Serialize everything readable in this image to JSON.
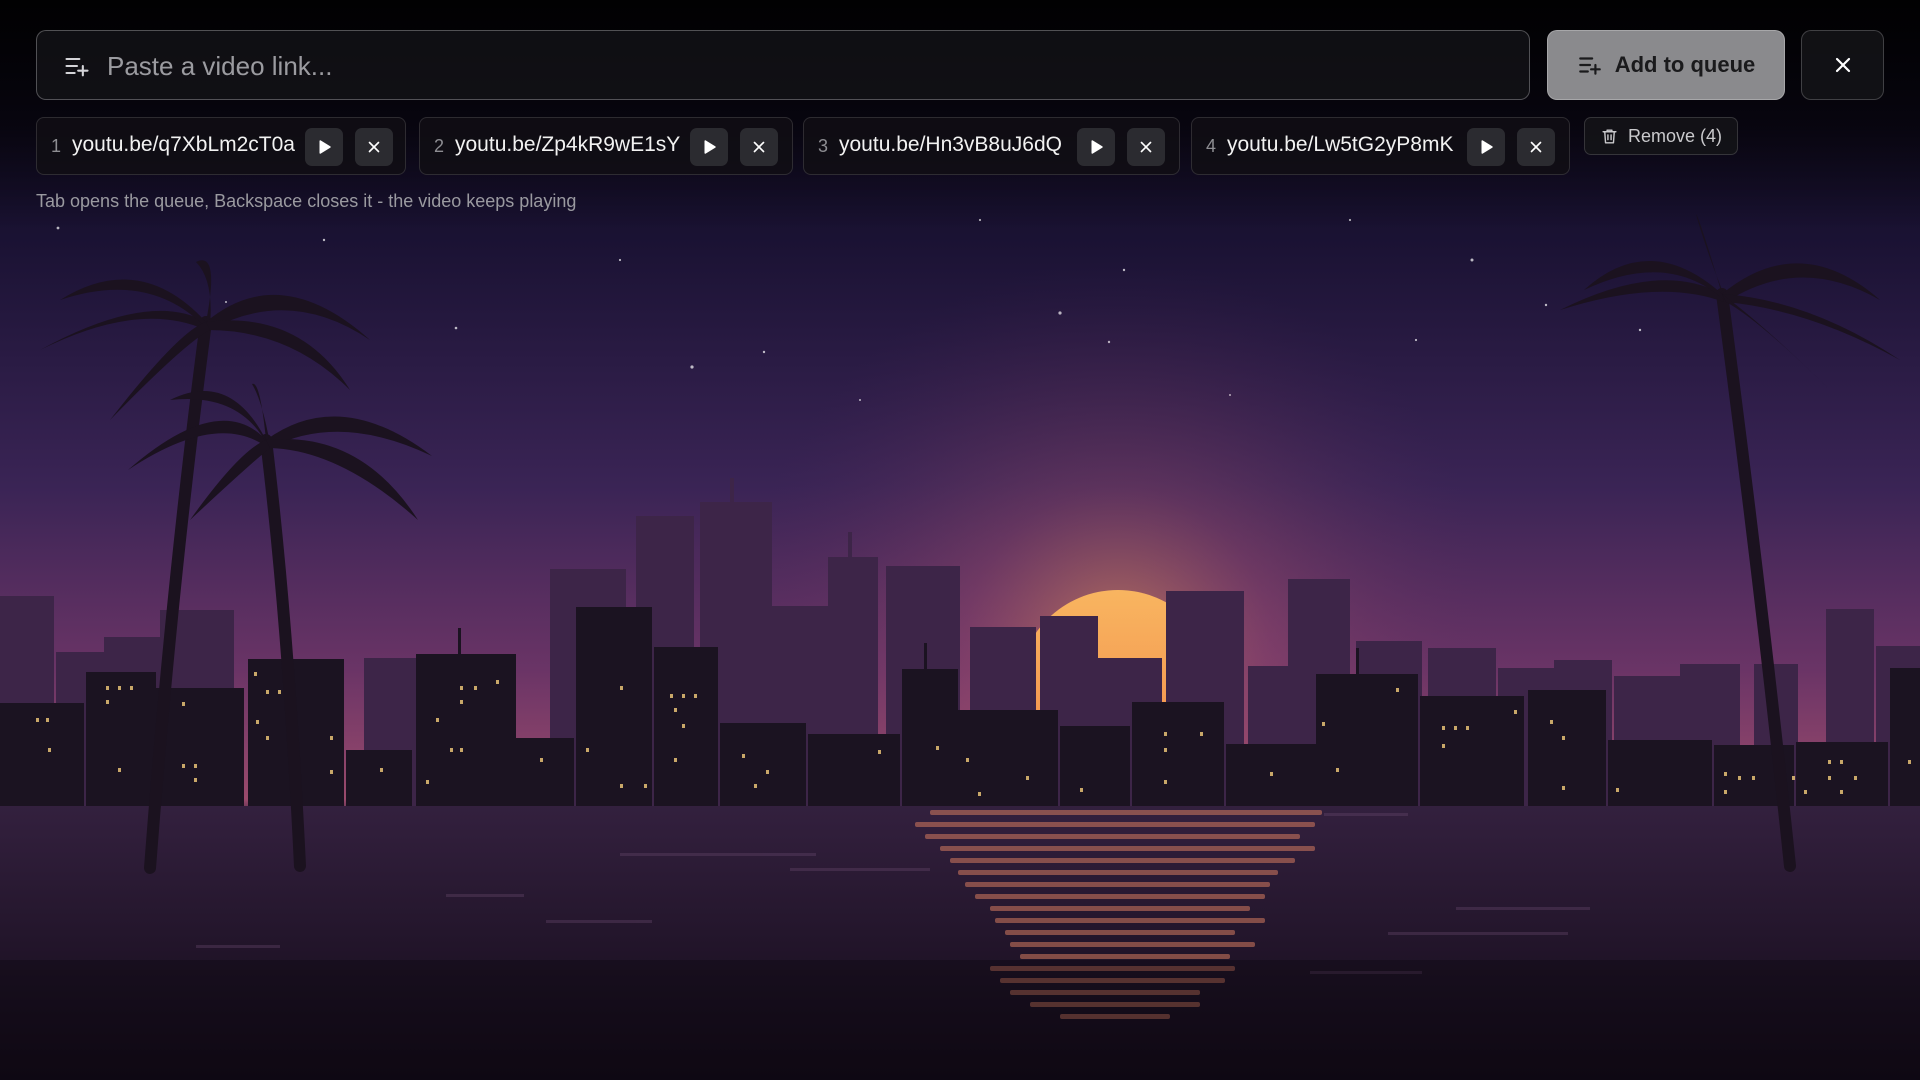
{
  "url_bar": {
    "placeholder": "Paste a video link...",
    "value": "",
    "icon": "playlist-add-icon"
  },
  "add_button": {
    "label": "Add to queue",
    "icon": "playlist-add-icon"
  },
  "close_button": {
    "icon": "close-icon"
  },
  "queue": {
    "items": [
      {
        "index": "1",
        "link": "youtu.be/q7XbLm2cT0a"
      },
      {
        "index": "2",
        "link": "youtu.be/Zp4kR9wE1sY"
      },
      {
        "index": "3",
        "link": "youtu.be/Hn3vB8uJ6dQ"
      },
      {
        "index": "4",
        "link": "youtu.be/Lw5tG2yP8mK"
      }
    ],
    "remove_label": "Remove (4)"
  },
  "hint": "Tab opens the queue, Backspace closes it - the video keeps playing",
  "colors": {
    "sky_top": "#160f2c",
    "sky_mid": "#3d2558",
    "horizon": "#8a3d6a",
    "sun": "#f6a94f",
    "buildings_back": "#3b2447",
    "buildings_front": "#1a1220",
    "water": "#2a1733",
    "window_light": "#e8c276",
    "button_grey": "#8a8a8d"
  }
}
